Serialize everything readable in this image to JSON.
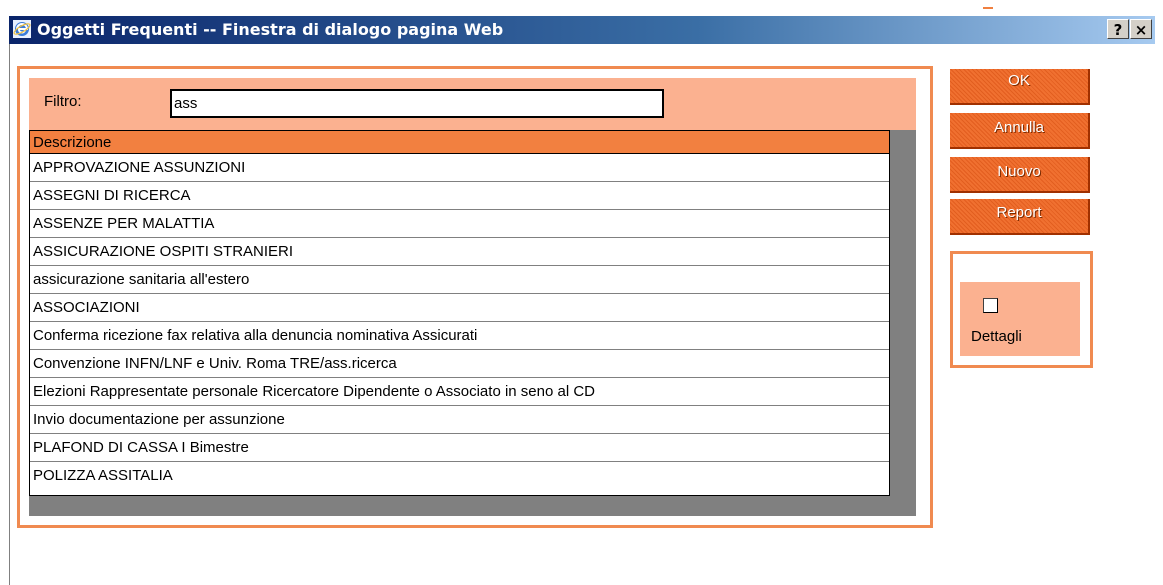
{
  "window": {
    "title": "Oggetti Frequenti -- Finestra di dialogo pagina Web",
    "help_label": "?",
    "close_label": "×"
  },
  "filter": {
    "label": "Filtro:",
    "value": "ass"
  },
  "grid": {
    "header": "Descrizione",
    "rows": [
      "APPROVAZIONE ASSUNZIONI",
      "ASSEGNI DI RICERCA",
      "ASSENZE PER MALATTIA",
      "ASSICURAZIONE OSPITI STRANIERI",
      "assicurazione sanitaria all'estero",
      "ASSOCIAZIONI",
      "Conferma ricezione fax relativa alla denuncia nominativa Assicurati",
      "Convenzione INFN/LNF e Univ. Roma TRE/ass.ricerca",
      "Elezioni Rappresentate personale Ricercatore Dipendente o Associato in seno al CD",
      "Invio documentazione per assunzione",
      "PLAFOND DI CASSA I Bimestre",
      "POLIZZA ASSITALIA"
    ]
  },
  "buttons": {
    "ok": "OK",
    "cancel": "Annulla",
    "new": "Nuovo",
    "report": "Report"
  },
  "details": {
    "label": "Dettagli",
    "checked": false
  },
  "colors": {
    "accent": "#f07030",
    "panel": "#fbb190",
    "header": "#f28040"
  }
}
